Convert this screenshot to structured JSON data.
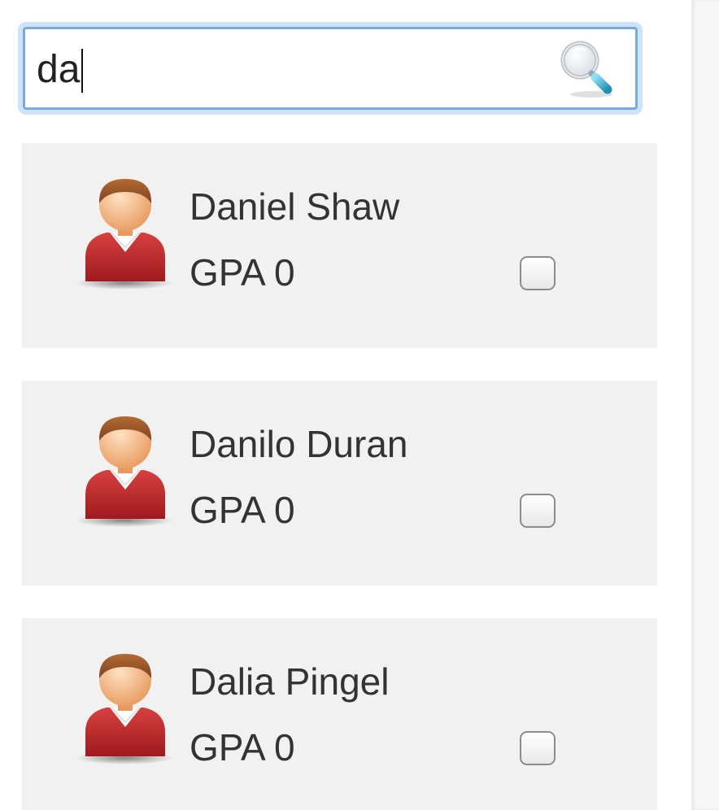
{
  "search": {
    "value": "da",
    "icon": "search-icon"
  },
  "students": [
    {
      "name": "Daniel Shaw",
      "gpa": "GPA 0",
      "checked": false,
      "icon": "student-avatar-icon"
    },
    {
      "name": "Danilo Duran",
      "gpa": "GPA 0",
      "checked": false,
      "icon": "student-avatar-icon"
    },
    {
      "name": "Dalia Pingel",
      "gpa": "GPA 0",
      "checked": false,
      "icon": "student-avatar-icon"
    }
  ],
  "colors": {
    "card_background": "#f1f1f1",
    "focus_ring": "#7aa9dc",
    "avatar_shirt": "#c0262a",
    "avatar_skin": "#f4b07a",
    "avatar_hair": "#9b5a2b"
  }
}
